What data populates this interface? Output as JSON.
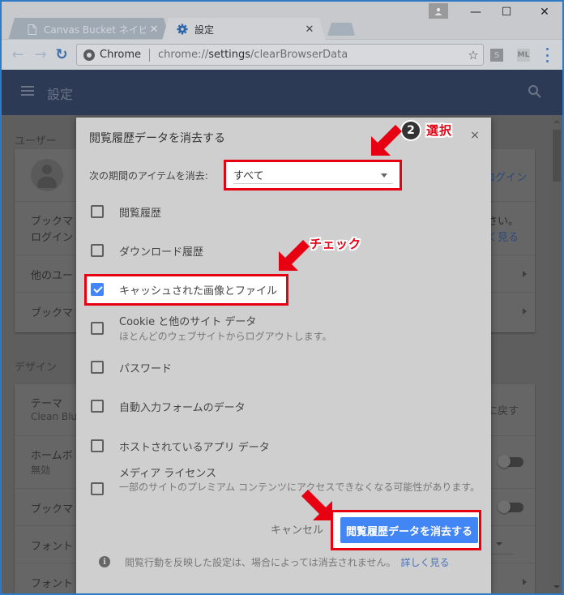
{
  "browser": {
    "tabs": [
      {
        "title": "Canvas Bucket ネイビー | す",
        "icon": "page-icon",
        "active": false
      },
      {
        "title": "設定",
        "icon": "gear-icon",
        "active": true
      }
    ],
    "omnibox": {
      "origin_label": "Chrome",
      "url_prefix": "chrome://",
      "url_host": "settings",
      "url_path": "/clearBrowserData"
    },
    "extensions": [
      "S",
      "ML"
    ],
    "window_controls": {
      "minimize": "—",
      "maximize": "☐",
      "close": "✕"
    }
  },
  "settings": {
    "title": "設定",
    "sections": [
      {
        "label": "ユーザー",
        "rows": [
          {
            "label": "",
            "right": "ログイン"
          },
          {
            "label": "ブックマ",
            "sub": "ログイン",
            "right_line1": "ださい。",
            "right_line2": "しく見る"
          },
          {
            "label": "他のユー"
          },
          {
            "label": "ブックマ"
          }
        ]
      },
      {
        "label": "デザイン",
        "rows": [
          {
            "label": "テーマ",
            "sub": "Clean Blu",
            "right": "トに戻す"
          },
          {
            "label": "ホームボ",
            "sub": "無効"
          },
          {
            "label": "ブックマ"
          },
          {
            "label": "フォント"
          },
          {
            "label": "フォント"
          }
        ]
      }
    ]
  },
  "dialog": {
    "title": "閲覧履歴データを消去する",
    "close_label": "×",
    "period_label": "次の期間のアイテムを消去:",
    "period_value": "すべて",
    "items": [
      {
        "label": "閲覧履歴",
        "checked": false
      },
      {
        "label": "ダウンロード履歴",
        "checked": false
      },
      {
        "label": "キャッシュされた画像とファイル",
        "checked": true
      },
      {
        "label": "Cookie と他のサイト データ",
        "sub": "ほとんどのウェブサイトからログアウトします。",
        "checked": false
      },
      {
        "label": "パスワード",
        "checked": false
      },
      {
        "label": "自動入力フォームのデータ",
        "checked": false
      },
      {
        "label": "ホストされているアプリ データ",
        "checked": false
      },
      {
        "label": "メディア ライセンス",
        "sub": "一部のサイトのプレミアム コンテンツにアクセスできなくなる可能性があります。",
        "checked": false
      }
    ],
    "cancel_label": "キャンセル",
    "confirm_label": "閲覧履歴データを消去する",
    "footer_text": "閲覧行動を反映した設定は、場合によっては消去されません。",
    "footer_link": "詳しく見る",
    "info_icon": "i"
  },
  "annotations": {
    "step_number": "2",
    "select_label": "選択",
    "check_label": "チェック",
    "highlight_color": "#e60012"
  },
  "colors": {
    "accent": "#4285f4",
    "header_bg": "#2c3a55",
    "annotation_red": "#e60012"
  }
}
